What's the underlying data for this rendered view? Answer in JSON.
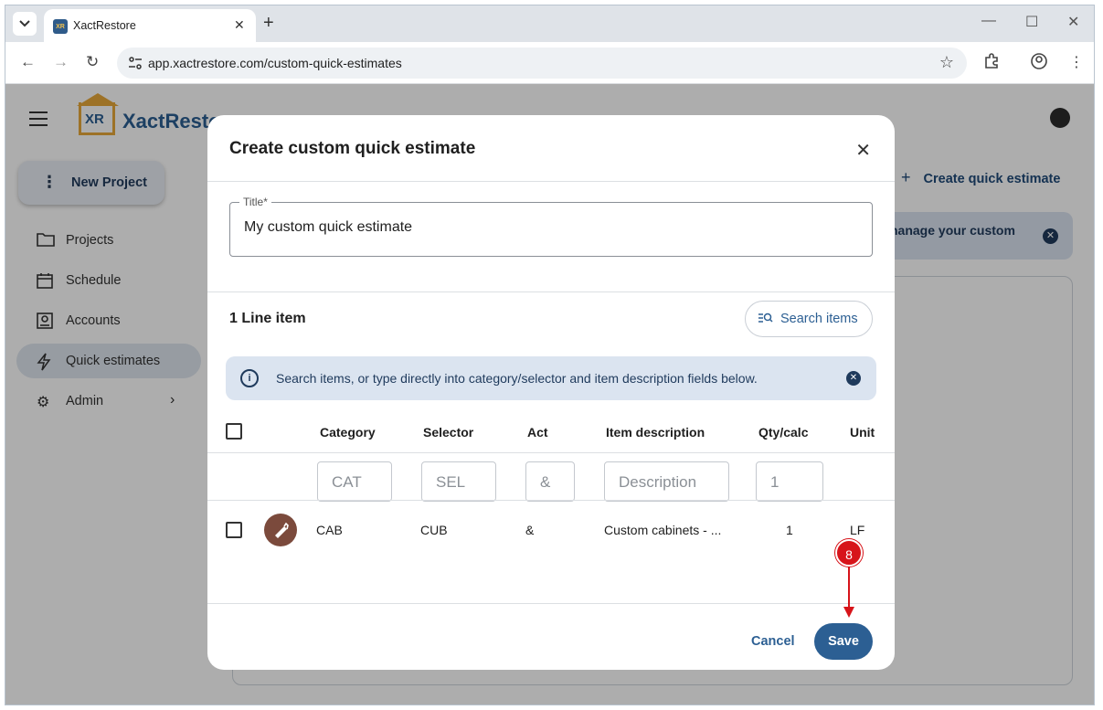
{
  "browser": {
    "tab_title": "XactRestore",
    "favicon_text": "XR",
    "url": "app.xactrestore.com/custom-quick-estimates"
  },
  "app": {
    "logo_mark": "XR",
    "logo_text": "XactRestore",
    "new_project_label": "New Project",
    "nav": [
      {
        "label": "Projects",
        "icon": "folder-icon"
      },
      {
        "label": "Schedule",
        "icon": "calendar-icon"
      },
      {
        "label": "Accounts",
        "icon": "contact-card-icon"
      },
      {
        "label": "Quick estimates",
        "icon": "lightning-icon",
        "active": true
      },
      {
        "label": "Admin",
        "icon": "gear-icon"
      }
    ],
    "create_quick_estimate": "Create quick estimate",
    "banner_text": "nanage your custom"
  },
  "modal": {
    "title": "Create custom quick estimate",
    "title_field_label": "Title*",
    "title_field_value": "My custom quick estimate",
    "line_count": "1 Line item",
    "search_items_label": "Search items",
    "hint_text": "Search items, or type directly into category/selector and item description fields below.",
    "columns": {
      "category": "Category",
      "selector": "Selector",
      "act": "Act",
      "description": "Item description",
      "qty": "Qty/calc",
      "unit": "Unit"
    },
    "new_row_placeholders": {
      "category": "CAT",
      "selector": "SEL",
      "act": "&",
      "description": "Description",
      "qty": "1"
    },
    "rows": [
      {
        "category": "CAB",
        "selector": "CUB",
        "act": "&",
        "description": "Custom cabinets - ...",
        "qty": "1",
        "unit": "LF"
      }
    ],
    "cancel_label": "Cancel",
    "save_label": "Save"
  },
  "annotation": {
    "step_number": "8",
    "color": "#d7141a"
  },
  "colors": {
    "primary": "#2c5f93",
    "logo_accent": "#e7a93a",
    "info_bg": "#dbe4f0"
  }
}
